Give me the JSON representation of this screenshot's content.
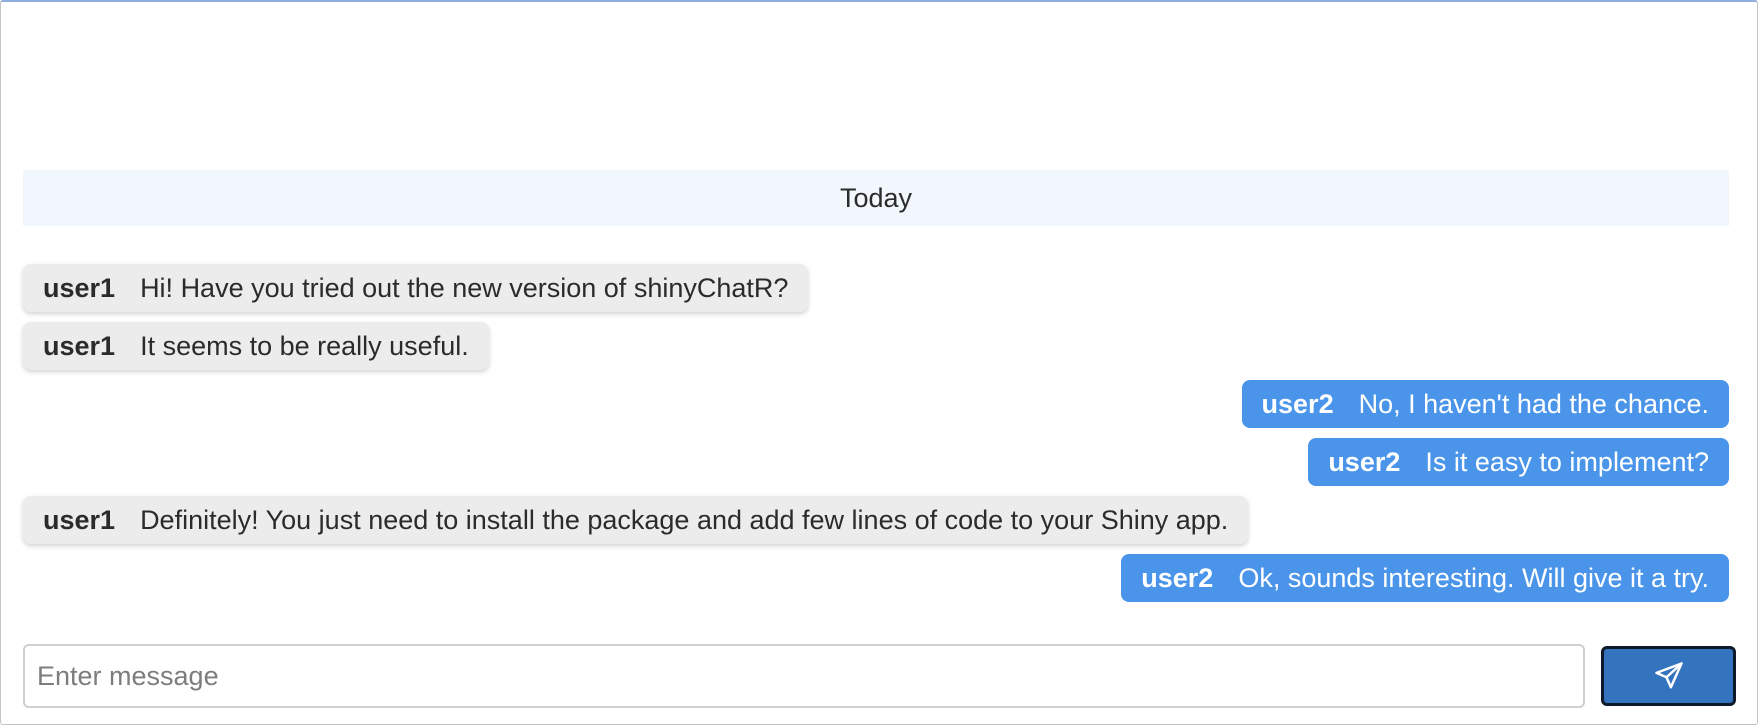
{
  "chat": {
    "day_separator": "Today",
    "messages": [
      {
        "side": "left",
        "user": "user1",
        "text": "Hi! Have you tried out the new version of shinyChatR?"
      },
      {
        "side": "left",
        "user": "user1",
        "text": "It seems to be really useful."
      },
      {
        "side": "right",
        "user": "user2",
        "text": "No, I haven't had the chance."
      },
      {
        "side": "right",
        "user": "user2",
        "text": "Is it easy to implement?"
      },
      {
        "side": "left",
        "user": "user1",
        "text": "Definitely! You just need to install the package and add few lines of code to your Shiny app."
      },
      {
        "side": "right",
        "user": "user2",
        "text": "Ok, sounds interesting. Will give it a try."
      }
    ]
  },
  "input": {
    "placeholder": "Enter message",
    "value": ""
  },
  "send_button": {
    "icon": "paper-plane-icon"
  },
  "colors": {
    "incoming_bubble": "#ececec",
    "outgoing_bubble": "#4a95ea",
    "send_button": "#3473bd",
    "day_separator_bg": "#f1f7fd"
  }
}
